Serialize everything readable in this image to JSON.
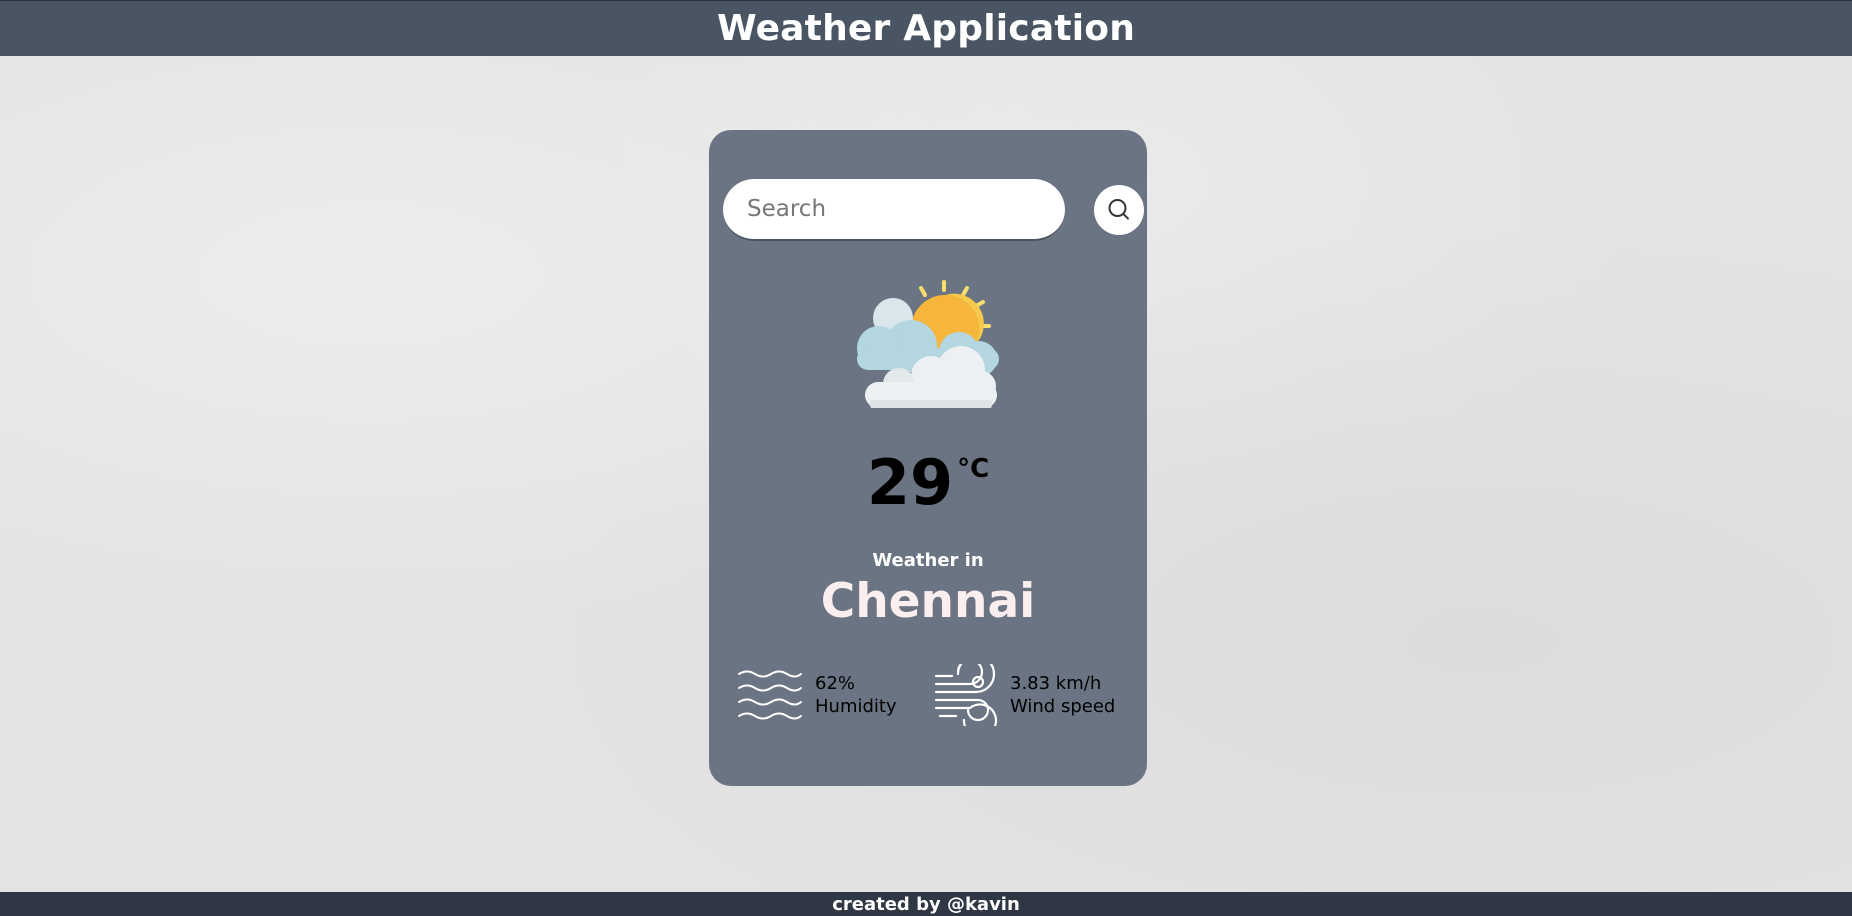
{
  "header": {
    "title": "Weather Application"
  },
  "search": {
    "placeholder": "Search",
    "value": ""
  },
  "weather": {
    "icon": "partly-cloudy-icon",
    "temperature": "29",
    "unit": "°C",
    "label": "Weather in",
    "city": "Chennai",
    "humidity_value": "62%",
    "humidity_label": "Humidity",
    "humidity_icon": "humidity-waves-icon",
    "wind_value": "3.83 km/h",
    "wind_label": "Wind speed",
    "wind_icon": "wind-icon"
  },
  "footer": {
    "text": "created by @kavin"
  },
  "colors": {
    "header_bg": "#4a5563",
    "card_bg": "#6a7483",
    "footer_bg": "#2e3743",
    "page_bg": "#e3e3e3"
  }
}
